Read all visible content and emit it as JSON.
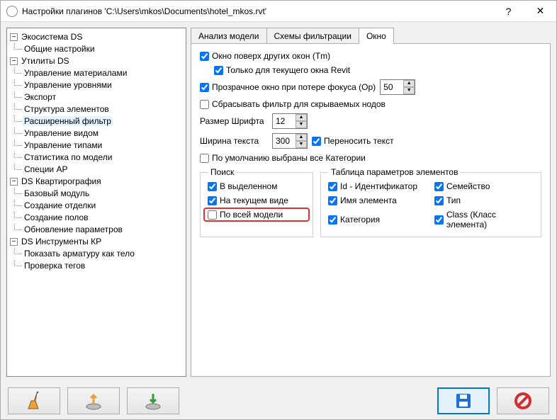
{
  "titlebar": {
    "title": "Настройки плагинов 'C:\\Users\\mkos\\Documents\\hotel_mkos.rvt'",
    "help": "?",
    "close": "✕"
  },
  "tree": {
    "nodes": [
      {
        "label": "Экосистема DS",
        "children": [
          {
            "label": "Общие настройки"
          }
        ]
      },
      {
        "label": "Утилиты DS",
        "children": [
          {
            "label": "Управление материалами"
          },
          {
            "label": "Управление уровнями"
          },
          {
            "label": "Экспорт"
          },
          {
            "label": "Структура элементов"
          },
          {
            "label": "Расширенный фильтр",
            "selected": true
          },
          {
            "label": "Управление видом"
          },
          {
            "label": "Управление типами"
          },
          {
            "label": "Статистика по модели"
          },
          {
            "label": "Специи АР"
          }
        ]
      },
      {
        "label": "DS Квартирография",
        "children": [
          {
            "label": "Базовый модуль"
          },
          {
            "label": "Создание отделки"
          },
          {
            "label": "Создание полов"
          },
          {
            "label": "Обновление параметров"
          }
        ]
      },
      {
        "label": "DS Инструменты КР",
        "children": [
          {
            "label": "Показать арматуру как тело"
          },
          {
            "label": "Проверка тегов"
          }
        ]
      }
    ]
  },
  "tabs": {
    "items": [
      "Анализ модели",
      "Схемы фильтрации",
      "Окно"
    ],
    "active": 2
  },
  "opts": {
    "topmost": "Окно поверх других окон (Tm)",
    "currentRevitOnly": "Только для текущего окна Revit",
    "transparentOnBlur": "Прозрачное окно при потере фокуса (Op)",
    "opacity": "50",
    "resetFilter": "Сбрасывать фильтр для скрываемых нодов",
    "fontSizeLabel": "Размер Шрифта",
    "fontSize": "12",
    "textWidthLabel": "Ширина текста",
    "textWidth": "300",
    "wrapText": "Переносить текст",
    "allCategories": "По умолчанию выбраны все Категории"
  },
  "search": {
    "legend": "Поиск",
    "inSelection": "В выделенном",
    "inCurrentView": "На текущем виде",
    "allModel": "По всей модели"
  },
  "paramTable": {
    "legend": "Таблица параметров элементов",
    "id": "Id - Идентификатор",
    "family": "Семейство",
    "elemName": "Имя элемента",
    "type": "Тип",
    "category": "Категория",
    "class": "Class (Класс элемента)"
  },
  "footer": {
    "brush": "clean",
    "export": "export",
    "import": "import",
    "save": "save",
    "cancel": "cancel"
  }
}
